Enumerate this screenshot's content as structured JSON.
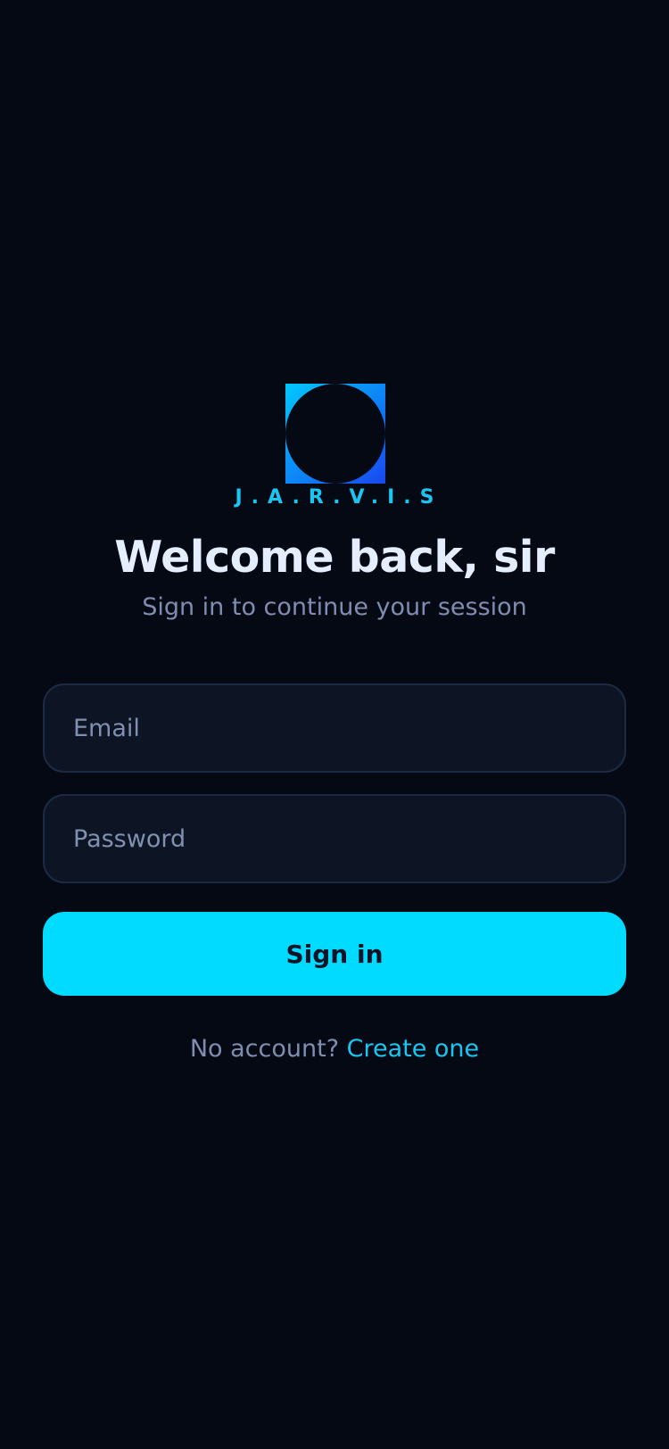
{
  "brand": {
    "logo_icon": "jarvis-logo-icon",
    "name": "J.A.R.V.I.S",
    "accent_start": "#00c8ff",
    "accent_end": "#1848f0"
  },
  "header": {
    "title": "Welcome back, sir",
    "subtitle": "Sign in to continue your session"
  },
  "form": {
    "email_placeholder": "Email",
    "email_value": "",
    "password_placeholder": "Password",
    "password_value": "",
    "submit_label": "Sign in",
    "submit_color": "#00dbff"
  },
  "footer": {
    "prompt": "No account?",
    "link_label": "Create one",
    "link_color": "#19c6f2"
  },
  "theme": {
    "background": "#050914",
    "field_background": "#0d1424"
  }
}
